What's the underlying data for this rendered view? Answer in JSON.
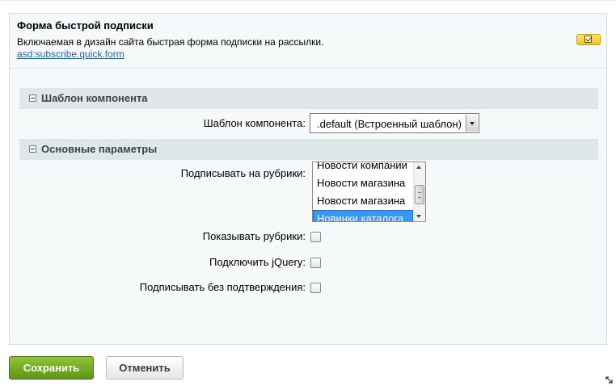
{
  "component": {
    "title": "Форма быстрой подписки",
    "description": "Включаемая в дизайн сайта быстрая форма подписки на рассылки.",
    "id_link": "asd:subscribe.quick.form"
  },
  "sections": [
    {
      "title": "Шаблон компонента"
    },
    {
      "title": "Основные параметры"
    }
  ],
  "template_field": {
    "label": "Шаблон компонента:",
    "value": ".default (Встроенный шаблон)"
  },
  "rubrics_field": {
    "label": "Подписывать на рубрики:",
    "options": [
      "Новости компании",
      "Новости магазина",
      "Новости магазина",
      "Новинки каталога"
    ],
    "selected_index": 3
  },
  "checkboxes": [
    {
      "label": "Показывать рубрики:",
      "checked": false
    },
    {
      "label": "Подключить jQuery:",
      "checked": false
    },
    {
      "label": "Подписывать без подтверждения:",
      "checked": false
    }
  ],
  "buttons": {
    "save_label": "Сохранить",
    "cancel_label": "Отменить"
  },
  "colors": {
    "save_button": "#6ea626",
    "toggle_button": "#f5c92a",
    "selected_option": "#3399ff"
  }
}
